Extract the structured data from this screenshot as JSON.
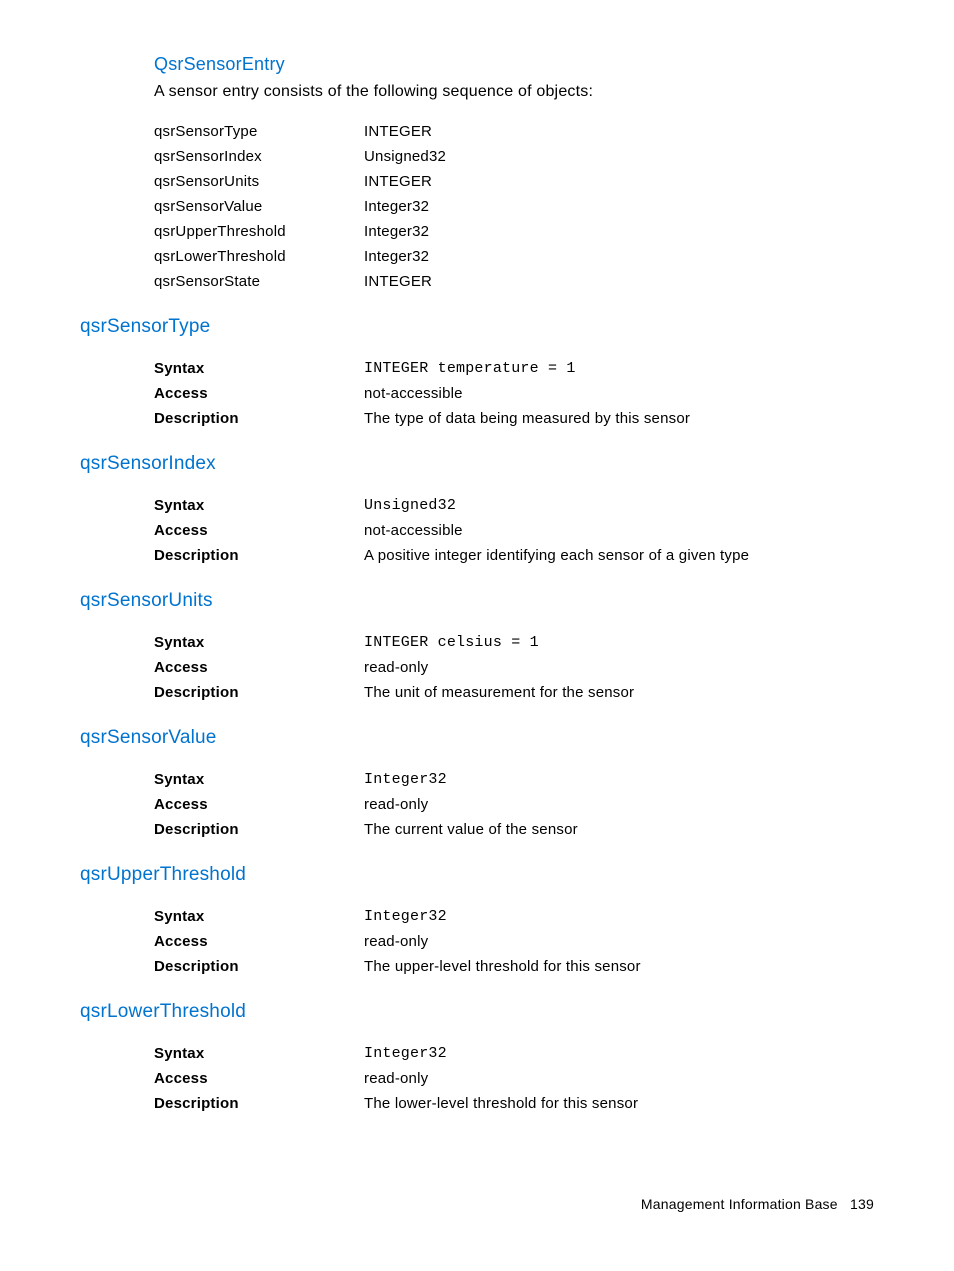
{
  "entry": {
    "heading": "QsrSensorEntry",
    "intro": "A sensor entry consists of the following sequence of objects:",
    "rows": [
      {
        "name": "qsrSensorType",
        "type": "INTEGER"
      },
      {
        "name": "qsrSensorIndex",
        "type": "Unsigned32"
      },
      {
        "name": "qsrSensorUnits",
        "type": "INTEGER"
      },
      {
        "name": "qsrSensorValue",
        "type": "Integer32"
      },
      {
        "name": "qsrUpperThreshold",
        "type": "Integer32"
      },
      {
        "name": "qsrLowerThreshold",
        "type": "Integer32"
      },
      {
        "name": "qsrSensorState",
        "type": "INTEGER"
      }
    ]
  },
  "labels": {
    "syntax": "Syntax",
    "access": "Access",
    "description": "Description"
  },
  "sections": [
    {
      "heading": "qsrSensorType",
      "syntax": "INTEGER temperature = 1",
      "syntax_mono": true,
      "access": "not-accessible",
      "description": "The type of data being measured by this sensor"
    },
    {
      "heading": "qsrSensorIndex",
      "syntax": "Unsigned32",
      "syntax_mono": true,
      "access": "not-accessible",
      "description": "A positive integer identifying each sensor of a given type"
    },
    {
      "heading": "qsrSensorUnits",
      "syntax": "INTEGER celsius = 1",
      "syntax_mono": true,
      "access": "read-only",
      "description": "The unit of measurement for the sensor"
    },
    {
      "heading": "qsrSensorValue",
      "syntax": "Integer32",
      "syntax_mono": true,
      "access": "read-only",
      "description": "The current value of the sensor"
    },
    {
      "heading": "qsrUpperThreshold",
      "syntax": "Integer32",
      "syntax_mono": true,
      "access": "read-only",
      "description": "The upper-level threshold for this sensor"
    },
    {
      "heading": "qsrLowerThreshold",
      "syntax": "Integer32",
      "syntax_mono": true,
      "access": "read-only",
      "description": "The lower-level threshold for this sensor"
    }
  ],
  "footer": {
    "title": "Management Information Base",
    "page": "139"
  }
}
